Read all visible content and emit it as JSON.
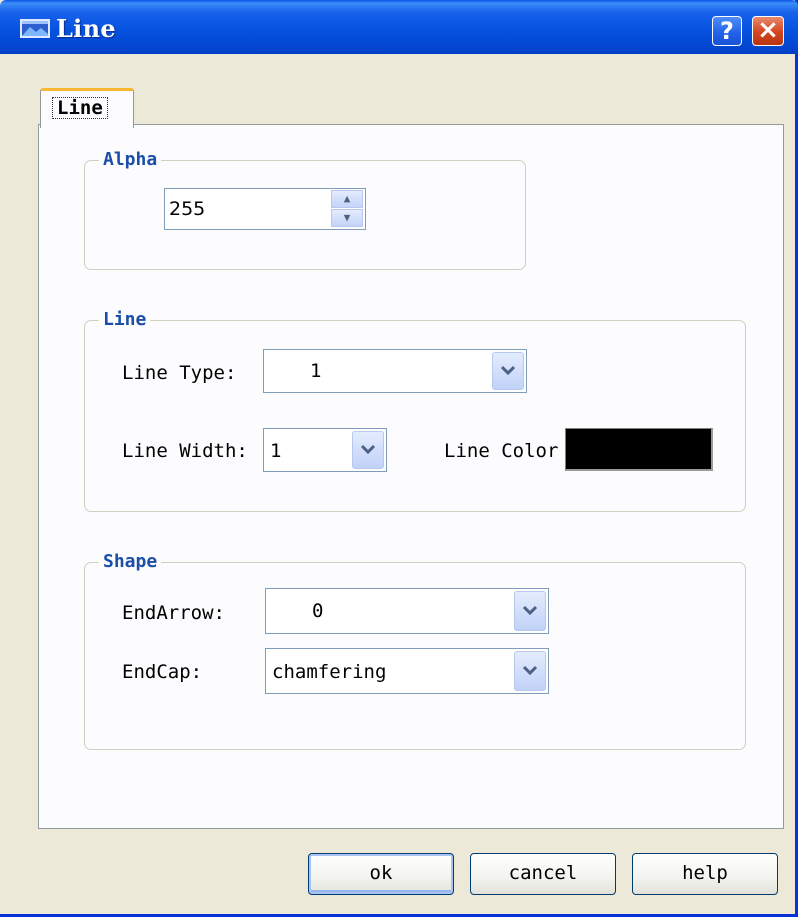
{
  "window": {
    "title": "Line"
  },
  "tabs": [
    {
      "label": "Line"
    }
  ],
  "alpha": {
    "legend": "Alpha",
    "value": "255"
  },
  "line": {
    "legend": "Line",
    "type_label": "Line Type:",
    "type_value": "1",
    "width_label": "Line Width:",
    "width_value": "1",
    "color_label": "Line Color",
    "color_value": "#000000"
  },
  "shape": {
    "legend": "Shape",
    "endarrow_label": "EndArrow:",
    "endarrow_value": "0",
    "endcap_label": "EndCap:",
    "endcap_value": "chamfering"
  },
  "buttons": {
    "ok": "ok",
    "cancel": "cancel",
    "help": "help"
  },
  "icons": {
    "title_help": "help-icon",
    "title_close": "close-icon"
  },
  "colors": {
    "titlebar": "#0553e0",
    "legend_text": "#1b4ea8",
    "dialog_bg": "#ece9d8"
  }
}
